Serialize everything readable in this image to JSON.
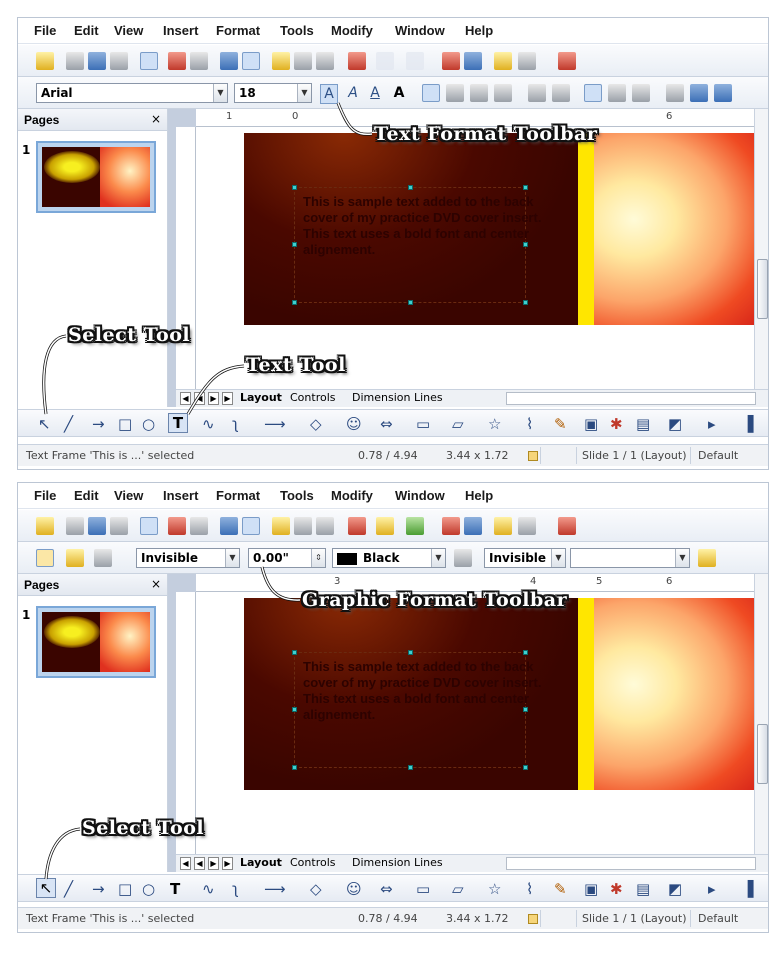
{
  "menu": [
    "File",
    "Edit",
    "View",
    "Insert",
    "Format",
    "Tools",
    "Modify",
    "Window",
    "Help"
  ],
  "panel1": {
    "font_name": "Arial",
    "font_size": "18",
    "callout_text_toolbar": "Text Format Toolbar",
    "callout_select_tool": "Select Tool",
    "callout_text_tool": "Text Tool"
  },
  "panel2": {
    "line_style": "Invisible",
    "line_width": "0.00\"",
    "line_color": "Black",
    "area_style": "Invisible",
    "area_fill": "",
    "callout_graphic_toolbar": "Graphic Format Toolbar",
    "callout_select_tool": "Select Tool"
  },
  "pages_panel": {
    "title": "Pages",
    "close": "×",
    "slide_number": "1"
  },
  "slide_text": "This is sample text added to the back cover of my practice DVD cover insert. This text uses a bold font and center alignement.",
  "tabs": {
    "layout": "Layout",
    "controls": "Controls",
    "dimension_lines": "Dimension Lines"
  },
  "ruler": {
    "marks": [
      "1",
      "0",
      "3",
      "4",
      "5",
      "6"
    ]
  },
  "status": {
    "selection": "Text Frame 'This is ...' selected",
    "position": "0.78 / 4.94",
    "size": "3.44 x 1.72",
    "slide": "Slide 1 / 1 (Layout)",
    "master": "Default"
  },
  "colors": {
    "accent_blue": "#3c6fb6",
    "slide_bg": "#3a0500",
    "yellow_band": "#ffe600",
    "handle": "#3fd0d0"
  }
}
